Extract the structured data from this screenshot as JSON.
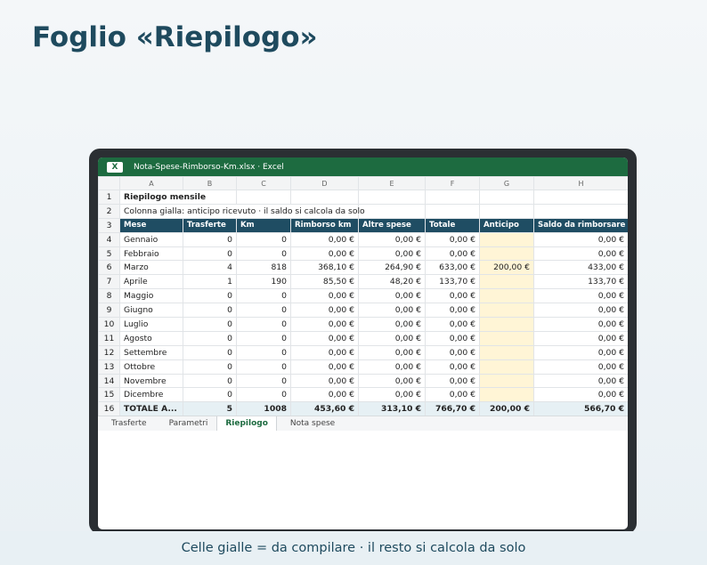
{
  "page_title": "Foglio «Riepilogo»",
  "window": {
    "file_title": "Nota-Spese-Rimborso-Km.xlsx · Excel",
    "app_icon_letter": "X"
  },
  "colors": {
    "excel_green": "#1d6b40",
    "header_navy": "#1f4d63",
    "input_yellow": "#fff5d6",
    "total_row": "#e6f0f4"
  },
  "sheet": {
    "column_letters": [
      "A",
      "B",
      "C",
      "D",
      "E",
      "F",
      "G",
      "H"
    ],
    "title": "Riepilogo mensile",
    "note": "Colonna gialla: anticipo ricevuto · il saldo si calcola da solo",
    "headers": [
      "Mese",
      "Trasferte",
      "Km",
      "Rimborso km",
      "Altre spese",
      "Totale",
      "Anticipo",
      "Saldo da rimborsare"
    ],
    "rows": [
      [
        "Gennaio",
        "0",
        "0",
        "0,00 €",
        "0,00 €",
        "0,00 €",
        "",
        "0,00 €"
      ],
      [
        "Febbraio",
        "0",
        "0",
        "0,00 €",
        "0,00 €",
        "0,00 €",
        "",
        "0,00 €"
      ],
      [
        "Marzo",
        "4",
        "818",
        "368,10 €",
        "264,90 €",
        "633,00 €",
        "200,00 €",
        "433,00 €"
      ],
      [
        "Aprile",
        "1",
        "190",
        "85,50 €",
        "48,20 €",
        "133,70 €",
        "",
        "133,70 €"
      ],
      [
        "Maggio",
        "0",
        "0",
        "0,00 €",
        "0,00 €",
        "0,00 €",
        "",
        "0,00 €"
      ],
      [
        "Giugno",
        "0",
        "0",
        "0,00 €",
        "0,00 €",
        "0,00 €",
        "",
        "0,00 €"
      ],
      [
        "Luglio",
        "0",
        "0",
        "0,00 €",
        "0,00 €",
        "0,00 €",
        "",
        "0,00 €"
      ],
      [
        "Agosto",
        "0",
        "0",
        "0,00 €",
        "0,00 €",
        "0,00 €",
        "",
        "0,00 €"
      ],
      [
        "Settembre",
        "0",
        "0",
        "0,00 €",
        "0,00 €",
        "0,00 €",
        "",
        "0,00 €"
      ],
      [
        "Ottobre",
        "0",
        "0",
        "0,00 €",
        "0,00 €",
        "0,00 €",
        "",
        "0,00 €"
      ],
      [
        "Novembre",
        "0",
        "0",
        "0,00 €",
        "0,00 €",
        "0,00 €",
        "",
        "0,00 €"
      ],
      [
        "Dicembre",
        "0",
        "0",
        "0,00 €",
        "0,00 €",
        "0,00 €",
        "",
        "0,00 €"
      ]
    ],
    "total": [
      "TOTALE A...",
      "5",
      "1008",
      "453,60 €",
      "313,10 €",
      "766,70 €",
      "200,00 €",
      "566,70 €"
    ]
  },
  "tabs": [
    "Trasferte",
    "Parametri",
    "Riepilogo",
    "Nota spese"
  ],
  "active_tab": "Riepilogo",
  "footer": "Celle gialle = da compilare · il resto si calcola da solo"
}
